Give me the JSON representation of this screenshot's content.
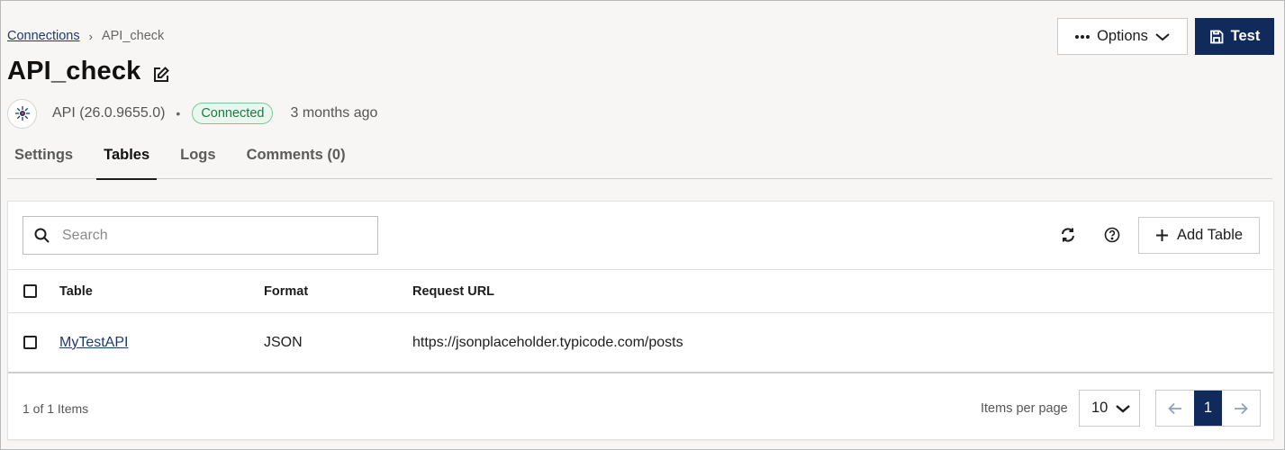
{
  "breadcrumb": {
    "parent": "Connections",
    "separator": "›",
    "current": "API_check"
  },
  "page": {
    "title": "API_check"
  },
  "meta": {
    "driver": "API (26.0.9655.0)",
    "bullet": "•",
    "status": "Connected",
    "updated": "3 months ago"
  },
  "header_actions": {
    "options_label": "Options",
    "test_label": "Test"
  },
  "tabs": [
    {
      "label": "Settings",
      "active": false
    },
    {
      "label": "Tables",
      "active": true
    },
    {
      "label": "Logs",
      "active": false
    },
    {
      "label": "Comments (0)",
      "active": false
    }
  ],
  "toolbar": {
    "search_placeholder": "Search",
    "add_label": "Add Table"
  },
  "table": {
    "headers": {
      "table": "Table",
      "format": "Format",
      "url": "Request URL"
    },
    "rows": [
      {
        "table": "MyTestAPI",
        "format": "JSON",
        "url": "https://jsonplaceholder.typicode.com/posts"
      }
    ]
  },
  "footer": {
    "count": "1 of 1 Items",
    "ipp_label": "Items per page",
    "ipp_value": "10",
    "current_page": "1"
  },
  "colors": {
    "brand": "#102a5c",
    "status_green": "#1d7a43",
    "link": "#1f3a6e"
  },
  "icons": [
    "edit-icon",
    "api-logo-icon",
    "ellipsis-icon",
    "chevron-down-icon",
    "save-icon",
    "search-icon",
    "refresh-icon",
    "help-icon",
    "plus-icon",
    "arrow-left-icon",
    "arrow-right-icon"
  ]
}
